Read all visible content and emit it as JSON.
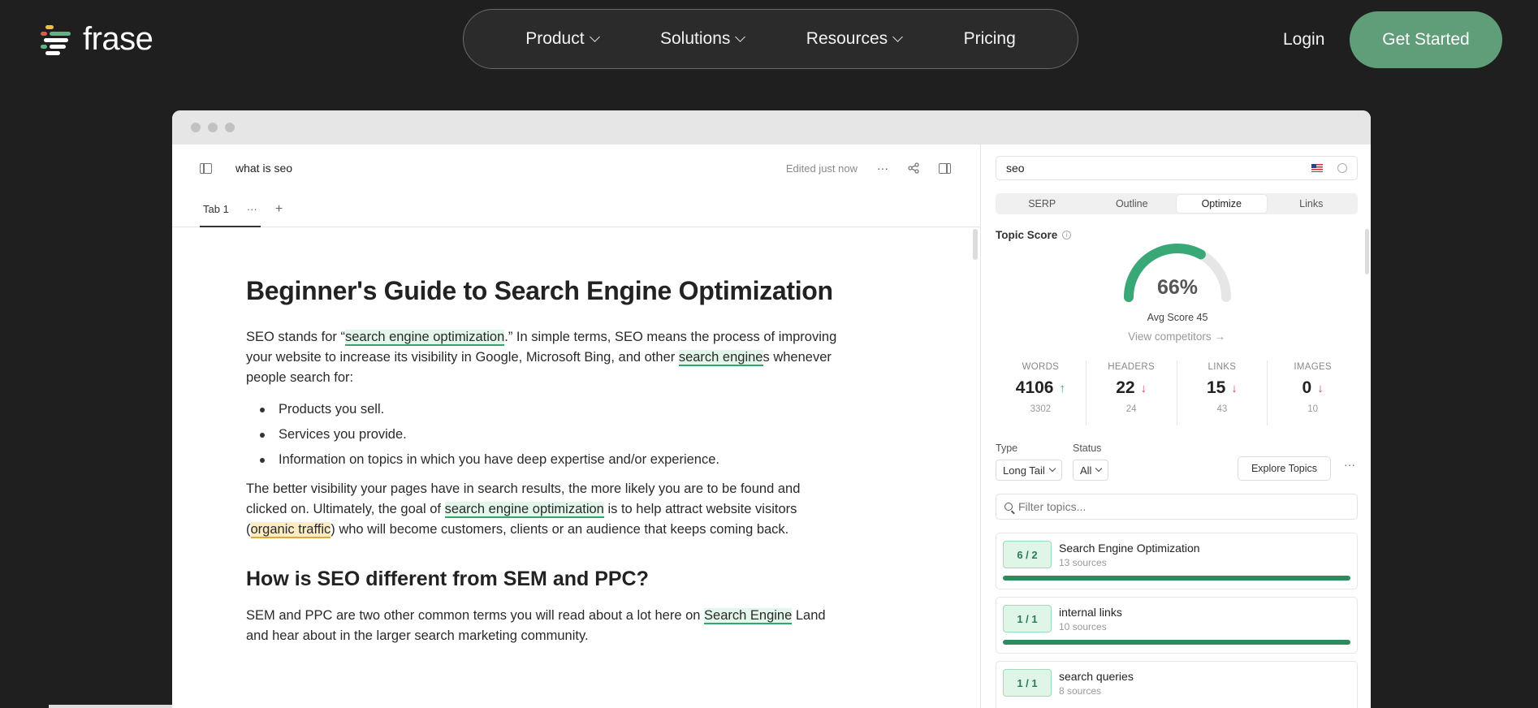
{
  "brand": {
    "name": "frase",
    "logo_colors": [
      "#f0c043",
      "#e0584d",
      "#5fb287",
      "#ffffff"
    ]
  },
  "nav": {
    "items": [
      {
        "label": "Product",
        "has_dropdown": true
      },
      {
        "label": "Solutions",
        "has_dropdown": true
      },
      {
        "label": "Resources",
        "has_dropdown": true
      },
      {
        "label": "Pricing",
        "has_dropdown": false
      }
    ],
    "login": "Login",
    "cta": "Get Started"
  },
  "editor": {
    "doc_title": "what is seo",
    "status": "Edited just now",
    "tab": {
      "label": "Tab 1",
      "menu": "···",
      "add": "+"
    },
    "heading": "Beginner's Guide to Search Engine Optimization",
    "p1": {
      "a": "SEO stands for “",
      "hl1": "search engine optimization",
      "b": ".” In simple terms, SEO means the process of improving your website to increase its visibility in Google, Microsoft Bing, and other ",
      "hl2": "search engine",
      "c": "s whenever people search for:"
    },
    "bullets": [
      "Products you sell.",
      "Services you provide.",
      "Information on topics in which you have deep expertise and/or experience."
    ],
    "p2": {
      "a": "The better visibility your pages have in search results, the more likely you are to be found and clicked on. Ultimately, the goal of ",
      "hl1": "search engine optimization",
      "b": " is to help attract website visitors (",
      "hl2": "organic traffic",
      "c": ") who will become customers, clients or an audience that keeps coming back."
    },
    "heading2": "How is SEO different from SEM and PPC?",
    "p3": {
      "a": "SEM and PPC are two other common terms you will read about a lot here on ",
      "hl1": "Search Engine",
      "b": " Land and hear about in the larger search marketing community."
    }
  },
  "panel": {
    "query": "seo",
    "tabs": [
      "SERP",
      "Outline",
      "Optimize",
      "Links"
    ],
    "active_tab": "Optimize",
    "topic_score": {
      "label": "Topic Score",
      "value": 66,
      "display": "66%",
      "avg": "Avg Score 45",
      "view_competitors": "View competitors →"
    },
    "stats": [
      {
        "key": "WORDS",
        "value": "4106",
        "trend": "up",
        "sub": "3302"
      },
      {
        "key": "HEADERS",
        "value": "22",
        "trend": "down",
        "sub": "24"
      },
      {
        "key": "LINKS",
        "value": "15",
        "trend": "down",
        "sub": "43"
      },
      {
        "key": "IMAGES",
        "value": "0",
        "trend": "down",
        "sub": "10"
      }
    ],
    "filters": {
      "type_label": "Type",
      "type_value": "Long Tail",
      "status_label": "Status",
      "status_value": "All",
      "explore": "Explore Topics",
      "more": "···"
    },
    "filter_placeholder": "Filter topics...",
    "topics": [
      {
        "badge": "6 / 2",
        "name": "Search Engine Optimization",
        "sources": "13 sources"
      },
      {
        "badge": "1 / 1",
        "name": "internal links",
        "sources": "10 sources"
      },
      {
        "badge": "1 / 1",
        "name": "search queries",
        "sources": "8 sources"
      }
    ]
  },
  "colors": {
    "bg": "#1f1f1f",
    "cta": "#5f9e78",
    "accent_green": "#35a56b",
    "down_red": "#d8485a"
  }
}
